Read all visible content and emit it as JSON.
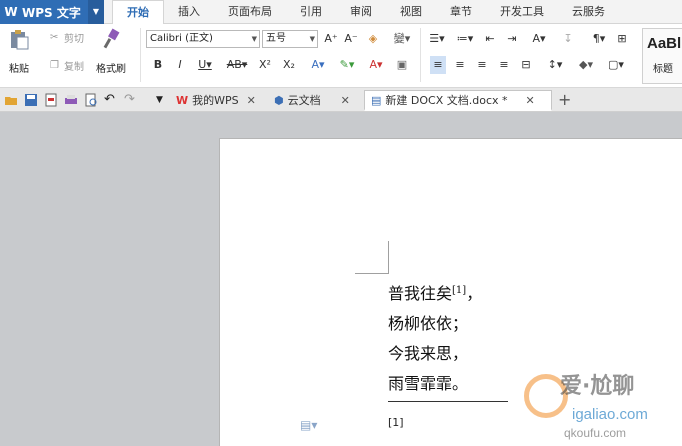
{
  "app": {
    "name": "WPS 文字",
    "logo": "W"
  },
  "menu_tabs": [
    "开始",
    "插入",
    "页面布局",
    "引用",
    "审阅",
    "视图",
    "章节",
    "开发工具",
    "云服务"
  ],
  "active_tab_index": 0,
  "ribbon": {
    "paste_label": "粘贴",
    "cut_label": "剪切",
    "copy_label": "复制",
    "format_painter_label": "格式刷",
    "font_name": "Calibri (正文)",
    "font_size": "五号",
    "style_sample": "AaBl",
    "style_name": "标题"
  },
  "doc_tabs": [
    {
      "label": "我的WPS"
    },
    {
      "label": "云文档"
    },
    {
      "label": "新建 DOCX 文档.docx *"
    }
  ],
  "document": {
    "lines": [
      "普我往矣",
      "杨柳依依；",
      "今我来思，",
      "雨雪霏霏。"
    ],
    "footnote_ref": "[1]",
    "first_line_suffix": "，",
    "footnote_text": "[1]"
  },
  "watermark": {
    "text": "爱·尬聊",
    "url": "igaliao.com",
    "url2": "qkoufu.com"
  },
  "colors": {
    "brand": "#2f6db5",
    "active_tab_text": "#2f6db5"
  }
}
